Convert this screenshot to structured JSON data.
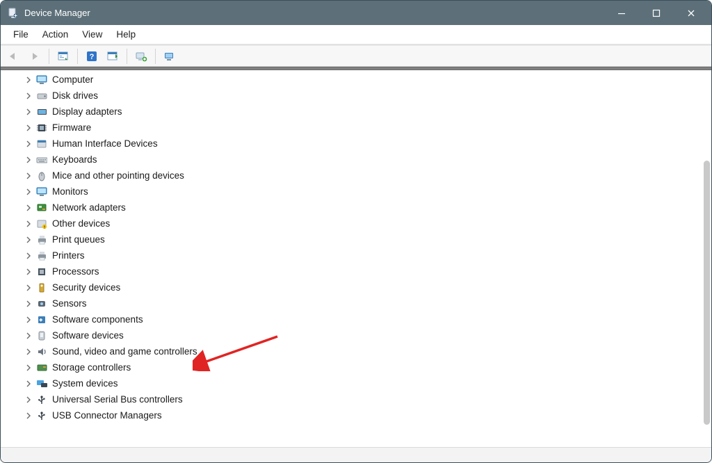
{
  "window": {
    "title": "Device Manager"
  },
  "menus": {
    "file": "File",
    "action": "Action",
    "view": "View",
    "help": "Help"
  },
  "toolbar": {
    "back": "Back",
    "forward": "Forward",
    "show_hidden": "Show hidden devices",
    "help": "Help",
    "update": "Update driver",
    "add_hw": "Add legacy hardware",
    "scan": "Scan for hardware changes"
  },
  "tree": [
    {
      "id": "computer",
      "label": "Computer",
      "icon": "monitor"
    },
    {
      "id": "disk-drives",
      "label": "Disk drives",
      "icon": "disk"
    },
    {
      "id": "display-adapters",
      "label": "Display adapters",
      "icon": "display"
    },
    {
      "id": "firmware",
      "label": "Firmware",
      "icon": "chip"
    },
    {
      "id": "hid",
      "label": "Human Interface Devices",
      "icon": "hid"
    },
    {
      "id": "keyboards",
      "label": "Keyboards",
      "icon": "keyboard"
    },
    {
      "id": "mice",
      "label": "Mice and other pointing devices",
      "icon": "mouse"
    },
    {
      "id": "monitors",
      "label": "Monitors",
      "icon": "monitor"
    },
    {
      "id": "network",
      "label": "Network adapters",
      "icon": "nic"
    },
    {
      "id": "other",
      "label": "Other devices",
      "icon": "other"
    },
    {
      "id": "print-queues",
      "label": "Print queues",
      "icon": "printer"
    },
    {
      "id": "printers",
      "label": "Printers",
      "icon": "printer"
    },
    {
      "id": "processors",
      "label": "Processors",
      "icon": "cpu"
    },
    {
      "id": "security",
      "label": "Security devices",
      "icon": "security"
    },
    {
      "id": "sensors",
      "label": "Sensors",
      "icon": "sensor"
    },
    {
      "id": "sw-components",
      "label": "Software components",
      "icon": "swcomp"
    },
    {
      "id": "sw-devices",
      "label": "Software devices",
      "icon": "swdev"
    },
    {
      "id": "sound",
      "label": "Sound, video and game controllers",
      "icon": "sound"
    },
    {
      "id": "storage",
      "label": "Storage controllers",
      "icon": "storage"
    },
    {
      "id": "system",
      "label": "System devices",
      "icon": "system"
    },
    {
      "id": "usb-controllers",
      "label": "Universal Serial Bus controllers",
      "icon": "usb"
    },
    {
      "id": "usb-connectors",
      "label": "USB Connector Managers",
      "icon": "usb"
    }
  ],
  "annotation": {
    "type": "arrow",
    "target": "sw-devices"
  }
}
